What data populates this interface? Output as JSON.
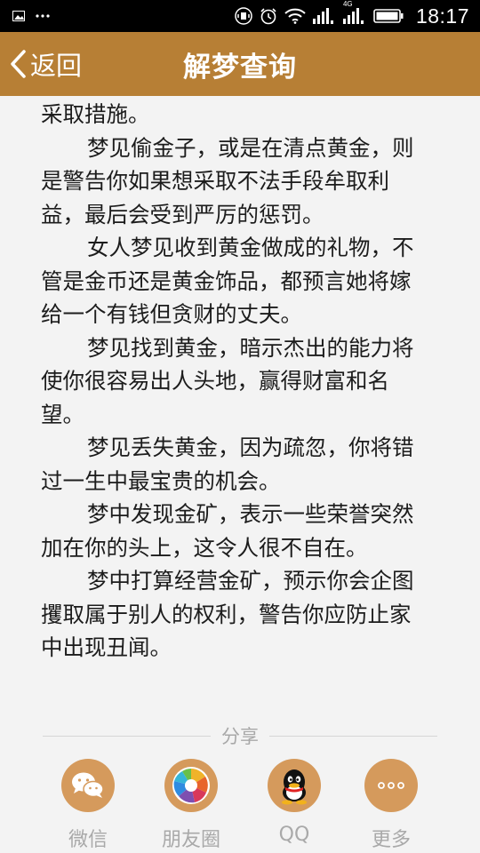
{
  "status_bar": {
    "time": "18:17",
    "network_label": "4G",
    "icons": [
      "image-icon",
      "more-icon",
      "vibrate-icon",
      "alarm-icon",
      "wifi-icon",
      "signal-icon",
      "battery-icon"
    ]
  },
  "header": {
    "back_label": "返回",
    "title": "解梦查询",
    "background_color": "#b77f35"
  },
  "article": {
    "first_line": "采取措施。",
    "paragraphs": [
      "梦见偷金子，或是在清点黄金，则是警告你如果想采取不法手段牟取利益，最后会受到严厉的惩罚。",
      "女人梦见收到黄金做成的礼物，不管是金币还是黄金饰品，都预言她将嫁给一个有钱但贪财的丈夫。",
      "梦见找到黄金，暗示杰出的能力将使你很容易出人头地，赢得财富和名望。",
      "梦见丢失黄金，因为疏忽，你将错过一生中最宝贵的机会。",
      "梦中发现金矿，表示一些荣誉突然加在你的头上，这令人很不自在。",
      "梦中打算经营金矿，预示你会企图攫取属于别人的权利，警告你应防止家中出现丑闻。"
    ]
  },
  "share": {
    "label": "分享",
    "circle_color": "#d59a5c",
    "items": [
      {
        "label": "微信",
        "icon": "wechat-icon"
      },
      {
        "label": "朋友圈",
        "icon": "moments-icon"
      },
      {
        "label": "QQ",
        "icon": "qq-icon"
      },
      {
        "label": "更多",
        "icon": "more-dots-icon"
      }
    ]
  }
}
